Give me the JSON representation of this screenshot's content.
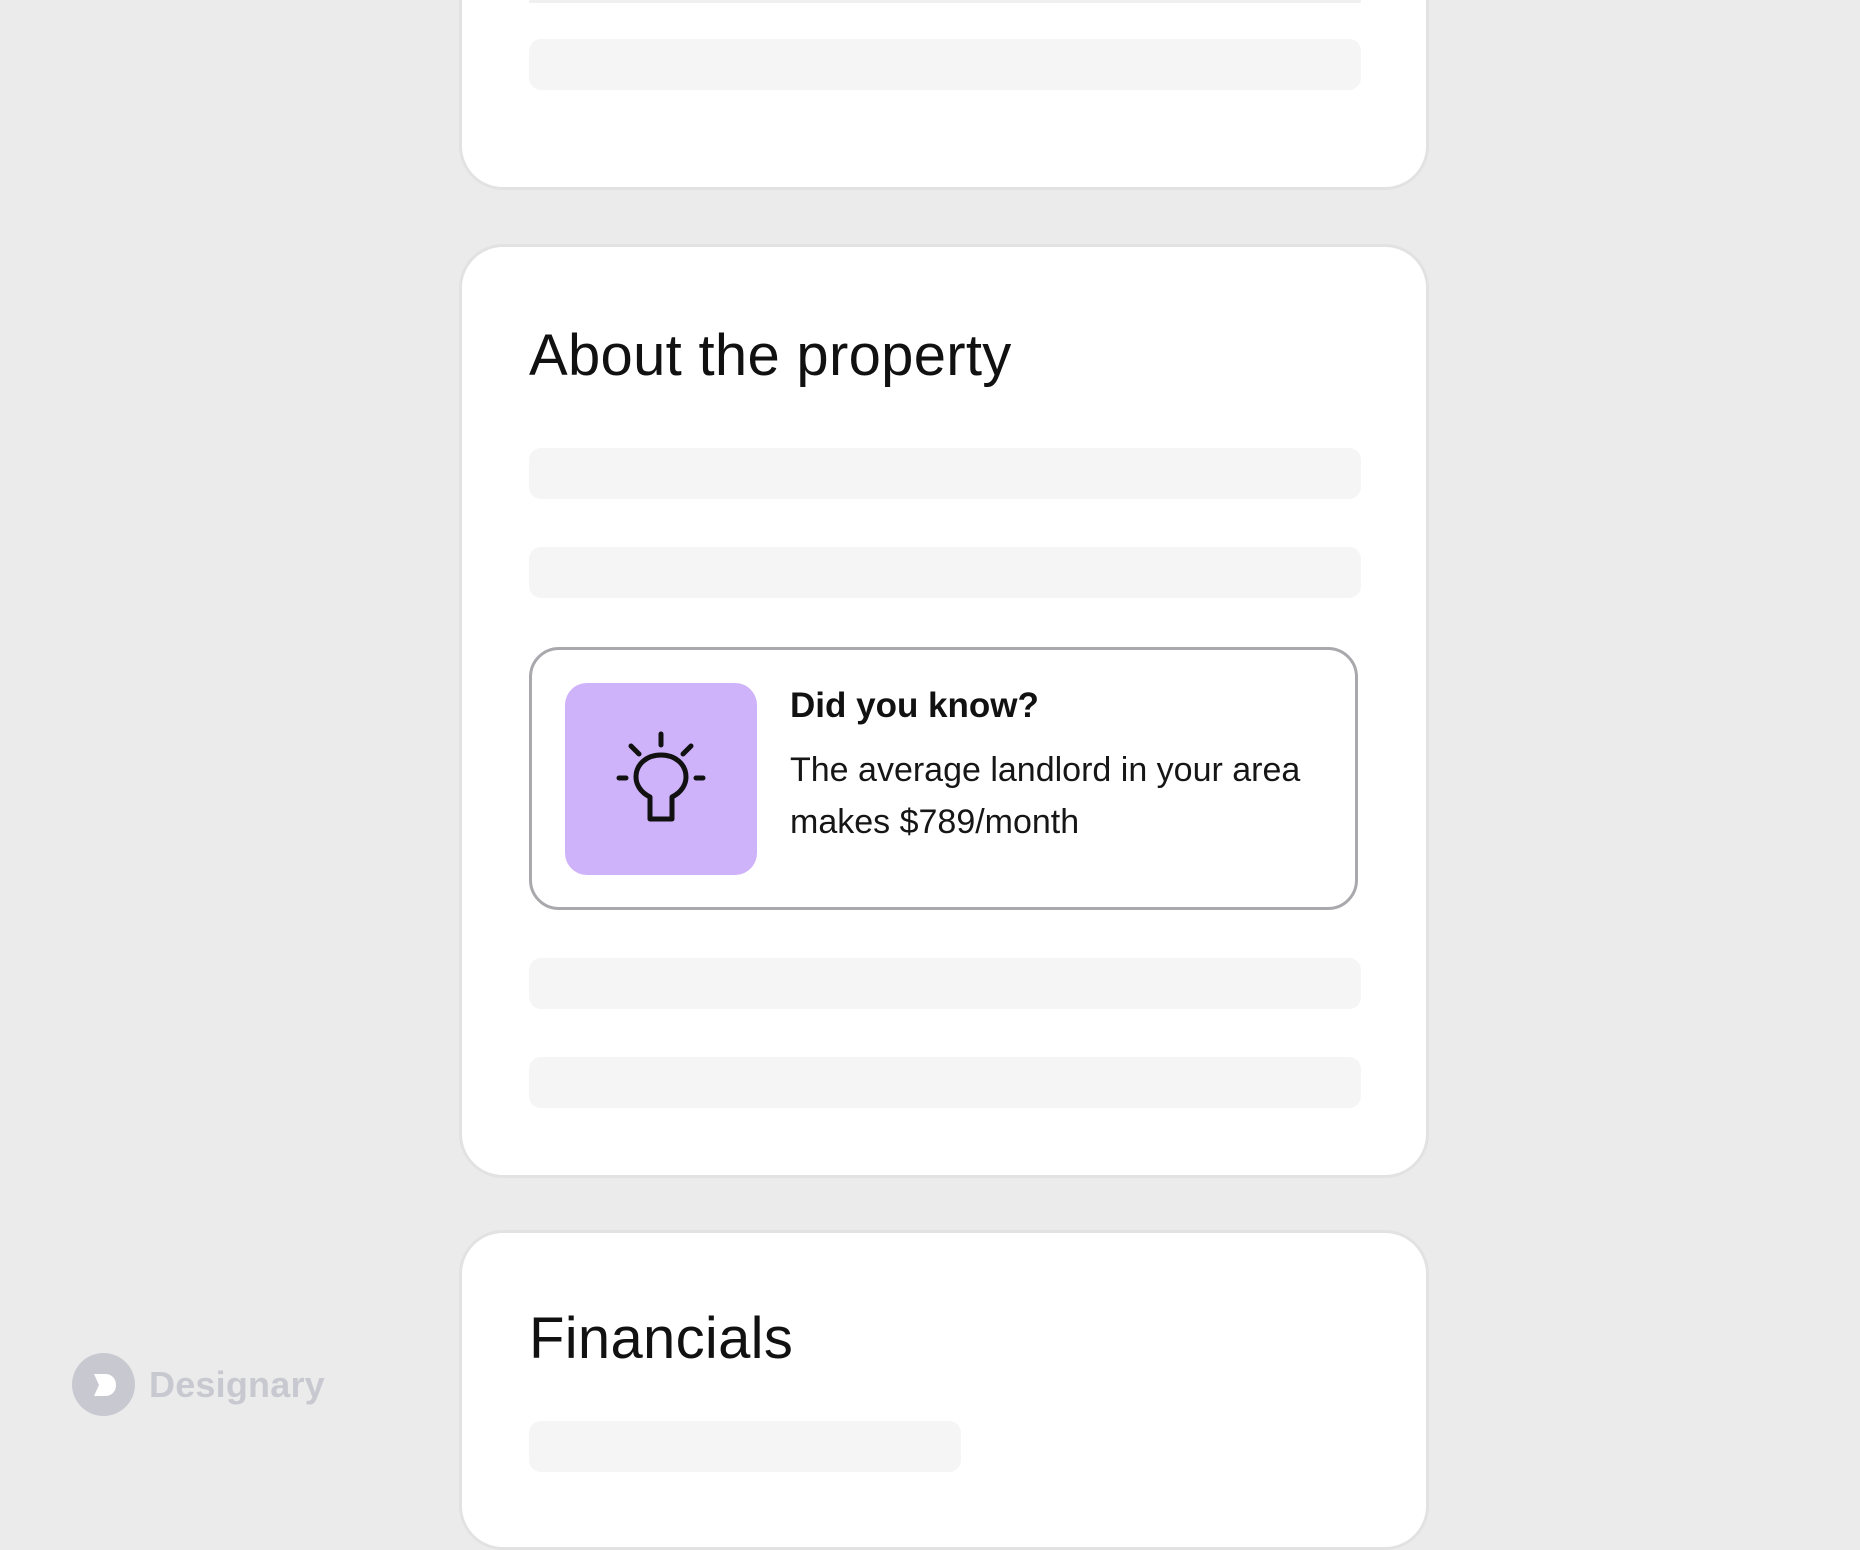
{
  "property_section": {
    "title": "About the property",
    "tip": {
      "title": "Did you know?",
      "body": "The average landlord in your area makes $789/month",
      "icon": "lightbulb-icon",
      "accent_color": "#cfb3fa"
    }
  },
  "financials_section": {
    "title": "Financials"
  },
  "watermark": {
    "name": "Designary",
    "icon": "designary-logo-icon"
  }
}
